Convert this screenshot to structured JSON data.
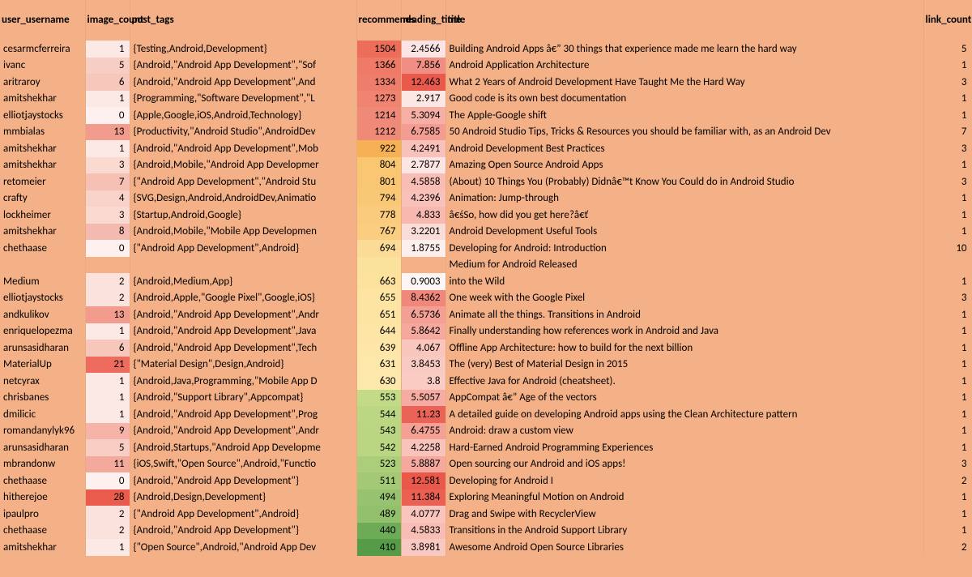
{
  "headers": {
    "username": "user_username",
    "image_count": "image_count",
    "post_tags": "post_tags",
    "recommends": "recommends",
    "reading_time": "reading_time",
    "title": "title",
    "link_count": "link_count"
  },
  "rows": [
    {
      "username": "cesarmcferreira",
      "img": 1,
      "imgBg": "#fce9e6",
      "tags": "{Testing,Android,Development}",
      "rec": 1504,
      "recBg": "#ec6d5a",
      "rt": "2.4566",
      "rtBg": "#fbe4e3",
      "title": "Building Android Apps â€” 30 things that experience made me learn the hard way",
      "link": 5
    },
    {
      "username": "ivanc",
      "img": 5,
      "imgBg": "#f8cdc3",
      "tags": "{Android,\"Android App Development\",\"Sof",
      "rec": 1366,
      "recBg": "#ee7a67",
      "rt": "7.856",
      "rtBg": "#f18e83",
      "title": "Android Application Architecture",
      "link": 1
    },
    {
      "username": "aritraroy",
      "img": 6,
      "imgBg": "#f7c7bc",
      "tags": "{Android,\"Android App Development\",And",
      "rec": 1334,
      "recBg": "#ef7d6b",
      "rt": "12.463",
      "rtBg": "#e9594c",
      "title": "What 2 Years of Android Development Have Taught Me the Hard Way",
      "link": 3
    },
    {
      "username": "amitshekhar",
      "img": 1,
      "imgBg": "#fce9e6",
      "tags": "{Programming,\"Software Development\",\"L",
      "rec": 1273,
      "recBg": "#f08471",
      "rt": "2.917",
      "rtBg": "#fde7e5",
      "title": "Good code is its own best documentation",
      "link": 1
    },
    {
      "username": "elliotjaystocks",
      "img": 0,
      "imgBg": "#fdf0ee",
      "tags": "{Apple,Google,iOS,Android,Technology}",
      "rec": 1214,
      "recBg": "#f08a78",
      "rt": "5.3094",
      "rtBg": "#f6afa5",
      "title": "The Apple-Google shift",
      "link": 1
    },
    {
      "username": "mmbialas",
      "img": 13,
      "imgBg": "#f29c8d",
      "tags": "{Productivity,\"Android Studio\",AndroidDev",
      "rec": 1212,
      "recBg": "#f08a78",
      "rt": "6.7585",
      "rtBg": "#f39c91",
      "title": "50 Android Studio Tips, Tricks & Resources you should be familiar with, as an Android Dev",
      "link": 7
    },
    {
      "username": "amitshekhar",
      "img": 1,
      "imgBg": "#fce9e6",
      "tags": "{Android,\"Android App Development\",Mob",
      "rec": 922,
      "recBg": "#f7b155",
      "rt": "4.2491",
      "rtBg": "#f8c2ba",
      "title": "Android Development Best Practices",
      "link": 3
    },
    {
      "username": "amitshekhar",
      "img": 3,
      "imgBg": "#fad9d1",
      "tags": "{Android,Mobile,\"Android App Developmer",
      "rec": 804,
      "recBg": "#f9c672",
      "rt": "2.7877",
      "rtBg": "#fce5e2",
      "title": "Amazing Open Source Android Apps",
      "link": 1
    },
    {
      "username": "retomeier",
      "img": 7,
      "imgBg": "#f6c0b4",
      "tags": "{\"Android App Development\",\"Android Stu",
      "rec": 801,
      "recBg": "#f9c774",
      "rt": "4.5858",
      "rtBg": "#f8bdb4",
      "title": "(About) 10 Things You (Probably) Didnâ€™t Know You Could do in Android Studio",
      "link": 3
    },
    {
      "username": "crafty",
      "img": 4,
      "imgBg": "#f9d3ca",
      "tags": "{SVG,Design,Android,AndroidDev,Animatio",
      "rec": 794,
      "recBg": "#f9c877",
      "rt": "4.2396",
      "rtBg": "#f8c2ba",
      "title": "Animation: Jump-through",
      "link": 1
    },
    {
      "username": "lockheimer",
      "img": 3,
      "imgBg": "#fad9d1",
      "tags": "{Startup,Android,Google}",
      "rec": 778,
      "recBg": "#facb7c",
      "rt": "4.833",
      "rtBg": "#f7b8af",
      "title": "â€śSo, how did you get here?â€ť",
      "link": 1
    },
    {
      "username": "amitshekhar",
      "img": 8,
      "imgBg": "#f5baaf",
      "tags": "{Android,Mobile,\"Mobile App Developmen",
      "rec": 767,
      "recBg": "#facd80",
      "rt": "3.2201",
      "rtBg": "#fadcd8",
      "title": "Android Development Useful Tools",
      "link": 1
    },
    {
      "username": "chethaase",
      "img": 0,
      "imgBg": "#fdf0ee",
      "tags": "{\"Android App Development\",Android}",
      "rec": 694,
      "recBg": "#fcdb97",
      "rt": "1.8755",
      "rtBg": "#fdefed",
      "title": "Developing for Android: Introduction",
      "link": 10
    },
    {
      "username": "",
      "img": "",
      "imgBg": "#f4b086",
      "tags": "",
      "rec": "",
      "recBg": "#fbe29c",
      "rt": "",
      "rtBg": "#f4b086",
      "title": "Medium for Android Released",
      "link": ""
    },
    {
      "username": "Medium",
      "img": 2,
      "imgBg": "#fbe2dc",
      "tags": "{Android,Medium,App}",
      "rec": 663,
      "recBg": "#fde29e",
      "rt": "0.9003",
      "rtBg": "#fef6f5",
      "title": "into the Wild",
      "link": 1
    },
    {
      "username": "elliotjaystocks",
      "img": 2,
      "imgBg": "#fbe2dc",
      "tags": "{Android,Apple,\"Google Pixel\",Google,iOS}",
      "rec": 655,
      "recBg": "#fde4a2",
      "rt": "8.4362",
      "rtBg": "#ef877b",
      "title": "One week with the Google Pixel",
      "link": 3
    },
    {
      "username": "andkulikov",
      "img": 13,
      "imgBg": "#f29c8d",
      "tags": "{Android,\"Android App Development\",Andr",
      "rec": 651,
      "recBg": "#fde4a3",
      "rt": "6.5736",
      "rtBg": "#f49f94",
      "title": "Animate all the things. Transitions in Android",
      "link": 1
    },
    {
      "username": "enriquelopezma",
      "img": 1,
      "imgBg": "#fce9e6",
      "tags": "{Android,\"Android App Development\",Java",
      "rec": 644,
      "recBg": "#fde5a5",
      "rt": "5.8642",
      "rtBg": "#f5a89e",
      "title": "Finally understanding how references work in Android and Java",
      "link": 1
    },
    {
      "username": "arunsasidharan",
      "img": 6,
      "imgBg": "#f7c7bc",
      "tags": "{Android,\"Android App Development\",Tech",
      "rec": 639,
      "recBg": "#fde6a7",
      "rt": "4.067",
      "rtBg": "#f9c6be",
      "title": "Offline App Architecture: how to build for the next billion",
      "link": 1
    },
    {
      "username": "MaterialUp",
      "img": 21,
      "imgBg": "#ed6c5d",
      "tags": "{\"Material Design\",Design,Android}",
      "rec": 631,
      "recBg": "#fde7aa",
      "rt": "3.8453",
      "rtBg": "#f9cac2",
      "title": "The (very) Best of Material Design in 2015",
      "link": 1
    },
    {
      "username": "netcyrax",
      "img": 1,
      "imgBg": "#fce9e6",
      "tags": "{Android,Java,Programming,\"Mobile App D",
      "rec": 630,
      "recBg": "#fde8ab",
      "rt": "3.8",
      "rtBg": "#f9cbc3",
      "title": "Effective Java for Android (cheatsheet).",
      "link": 1
    },
    {
      "username": "chrisbanes",
      "img": 1,
      "imgBg": "#fce9e6",
      "tags": "{Android,\"Support Library\",Appcompat}",
      "rec": 553,
      "recBg": "#c3da86",
      "rt": "5.5057",
      "rtBg": "#f6aca2",
      "title": "AppCompat â€” Age of the vectors",
      "link": 1
    },
    {
      "username": "dmilicic",
      "img": 1,
      "imgBg": "#fce9e6",
      "tags": "{Android,\"Android App Development\",Prog",
      "rec": 544,
      "recBg": "#bcd783",
      "rt": "11.23",
      "rtBg": "#ea6356",
      "title": "A detailed guide on developing Android apps using the Clean Architecture pattern",
      "link": 1
    },
    {
      "username": "romandanylyk96",
      "img": 9,
      "imgBg": "#f5b4a7",
      "tags": "{Android,\"Android App Development\",Andr",
      "rec": 543,
      "recBg": "#bbd682",
      "rt": "6.4755",
      "rtBg": "#f4a095",
      "title": "Android: draw a custom view",
      "link": 1
    },
    {
      "username": "arunsasidharan",
      "img": 5,
      "imgBg": "#f8cdc3",
      "tags": "{Android,Startups,\"Android App Developme",
      "rec": 542,
      "recBg": "#bad682",
      "rt": "4.2258",
      "rtBg": "#f8c3bb",
      "title": "Hard-Earned Android Programming Experiences",
      "link": 1
    },
    {
      "username": "mbrandonw",
      "img": 11,
      "imgBg": "#f3a99b",
      "tags": "{iOS,Swift,\"Open Source\",Android,\"Functio",
      "rec": 523,
      "recBg": "#acce7b",
      "rt": "5.8887",
      "rtBg": "#f5a89e",
      "title": "Open sourcing our Android and iOS apps!",
      "link": 3
    },
    {
      "username": "chethaase",
      "img": 0,
      "imgBg": "#fdf0ee",
      "tags": "{Android,\"Android App Development\"}",
      "rec": 511,
      "recBg": "#a3c976",
      "rt": "12.581",
      "rtBg": "#e9584b",
      "title": "Developing for Android I",
      "link": 2
    },
    {
      "username": "hitherejoe",
      "img": 28,
      "imgBg": "#ea5b4e",
      "tags": "{Android,Design,Development}",
      "rec": 494,
      "recBg": "#97c26f",
      "rt": "11.384",
      "rtBg": "#ea6154",
      "title": "Exploring Meaningful Motion on Android",
      "link": 1
    },
    {
      "username": "ipaulpro",
      "img": 2,
      "imgBg": "#fbe2dc",
      "tags": "{\"Android App Development\",Android}",
      "rec": 489,
      "recBg": "#93c06d",
      "rt": "4.0777",
      "rtBg": "#f9c5bd",
      "title": "Drag and Swipe with RecyclerView",
      "link": 1
    },
    {
      "username": "chethaase",
      "img": 2,
      "imgBg": "#fbe2dc",
      "tags": "{Android,\"Android App Development\"}",
      "rec": 440,
      "recBg": "#6dab57",
      "rt": "4.5833",
      "rtBg": "#f8bdb4",
      "title": "Transitions in the Android Support Library",
      "link": 1
    },
    {
      "username": "amitshekhar",
      "img": 1,
      "imgBg": "#fce9e6",
      "tags": "{\"Open Source\",Android,\"Android App Dev",
      "rec": 410,
      "recBg": "#569c48",
      "rt": "3.8981",
      "rtBg": "#f9c9c1",
      "title": "Awesome Android Open Source Libraries",
      "link": 2
    }
  ]
}
